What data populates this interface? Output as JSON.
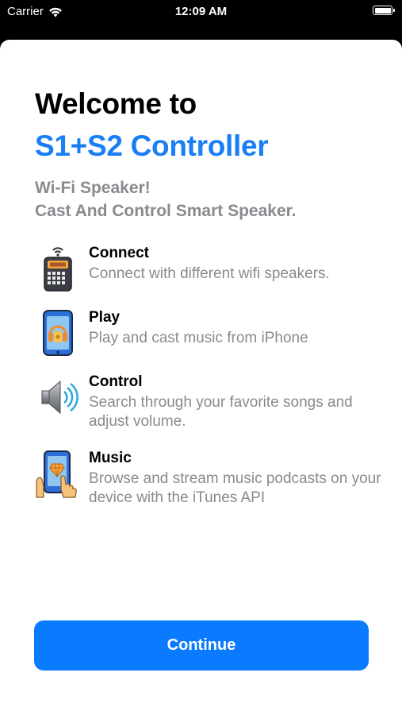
{
  "status_bar": {
    "carrier": "Carrier",
    "time": "12:09 AM"
  },
  "header": {
    "title_line1": "Welcome to",
    "title_line2": "S1+S2 Controller",
    "subtitle_line1": "Wi-Fi Speaker!",
    "subtitle_line2": "Cast And Control Smart Speaker."
  },
  "features": [
    {
      "icon": "radio-speaker-icon",
      "title": "Connect",
      "description": "Connect with different wifi speakers."
    },
    {
      "icon": "phone-headphones-icon",
      "title": "Play",
      "description": "Play and cast music from iPhone"
    },
    {
      "icon": "speaker-volume-icon",
      "title": "Control",
      "description": "Search through your favorite songs and adjust volume."
    },
    {
      "icon": "phone-diamond-hand-icon",
      "title": "Music",
      "description": "Browse and stream music podcasts on your device with the iTunes API"
    }
  ],
  "continue_label": "Continue",
  "colors": {
    "accent": "#0a7bff",
    "title_blue": "#1a7ef5",
    "subtitle_gray": "#888a8e"
  }
}
